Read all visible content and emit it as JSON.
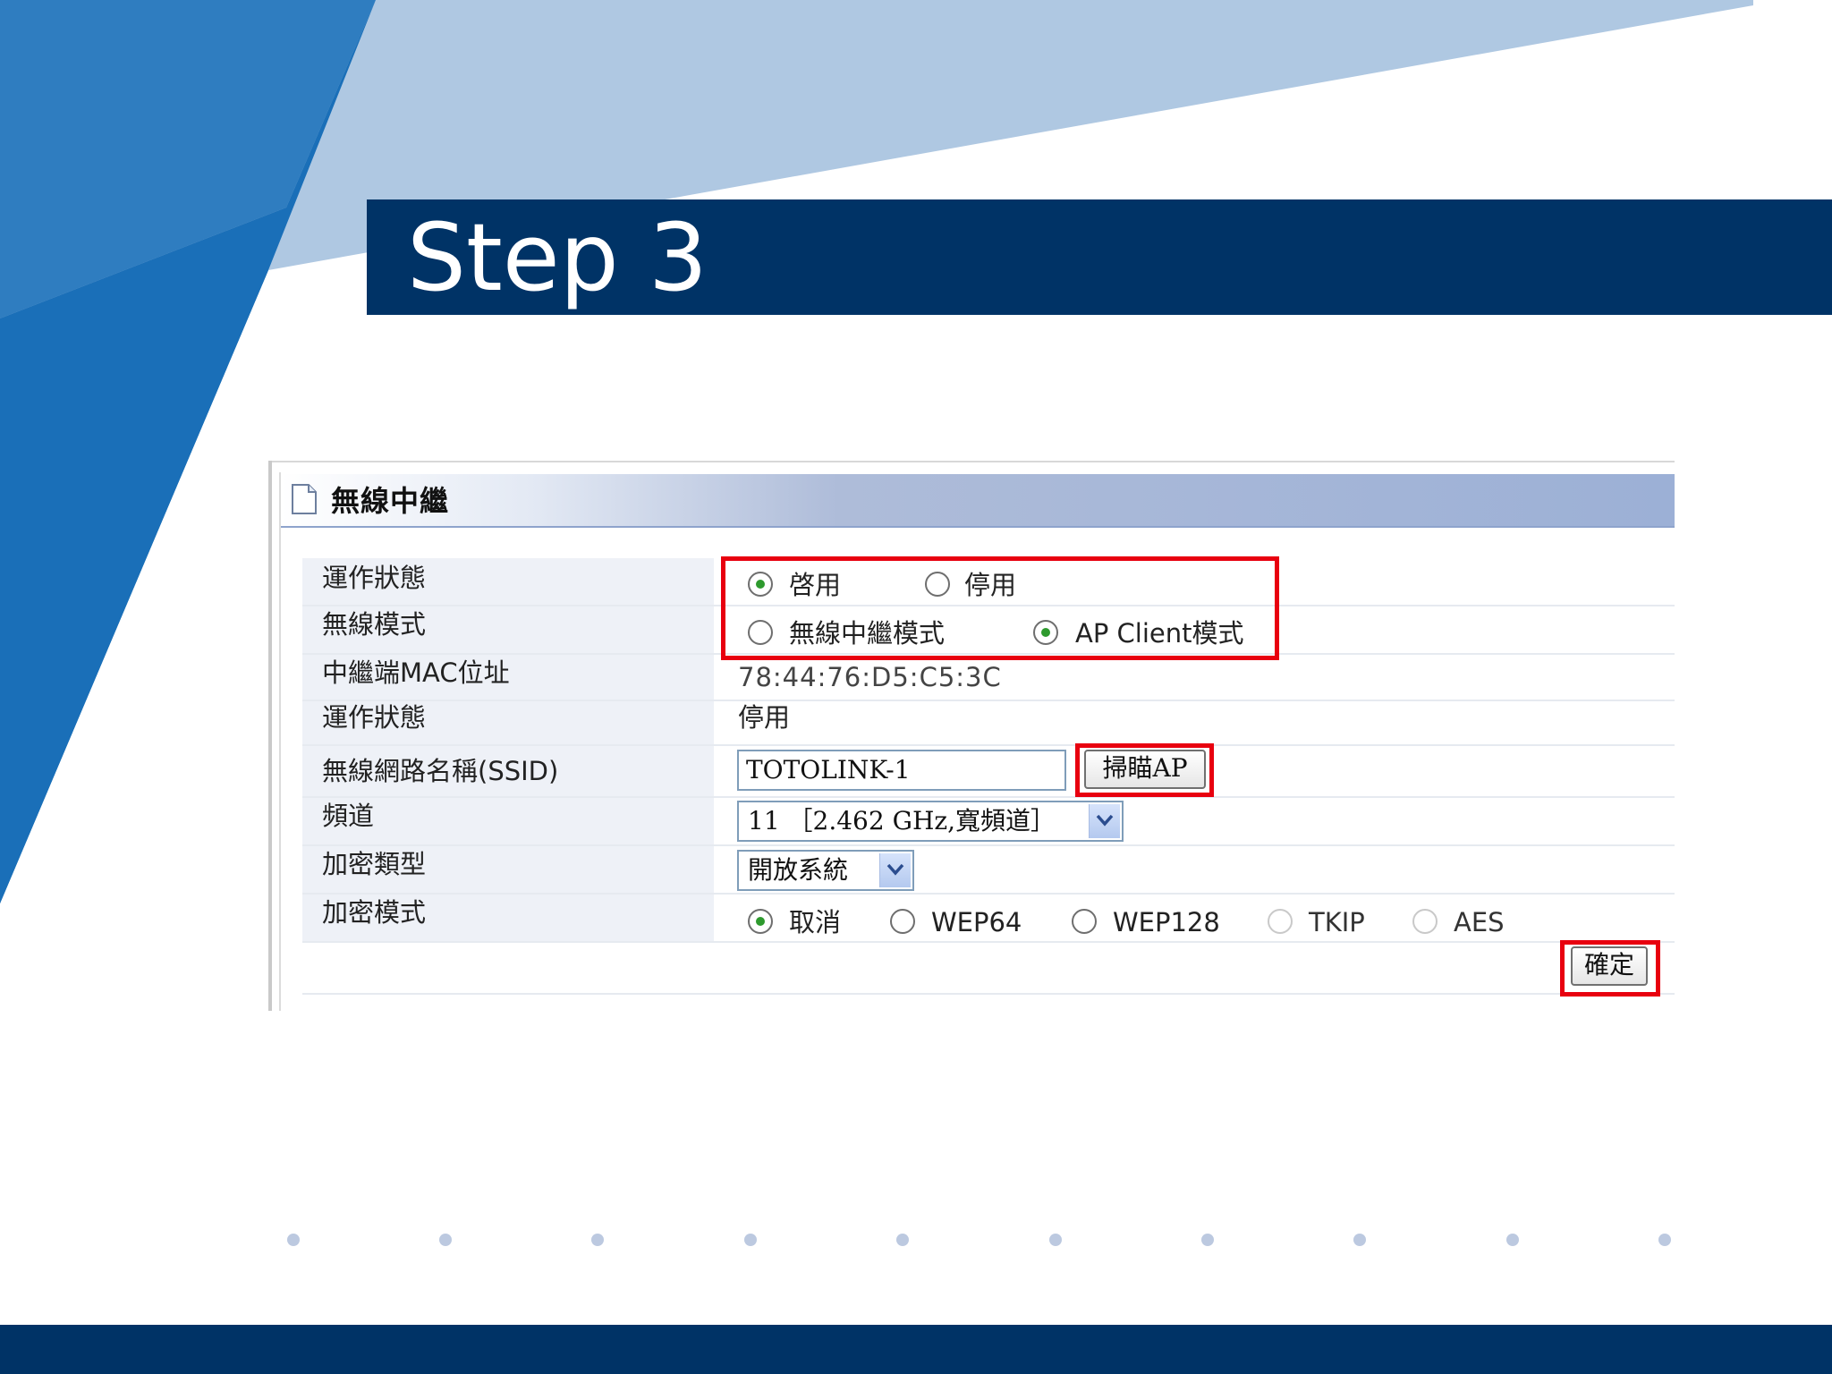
{
  "slide": {
    "title": "Step 3",
    "colors": {
      "navy": "#003366",
      "blue": "#0061ab",
      "light_blue": "#afc8e2",
      "highlight": "#e8000f"
    }
  },
  "panel": {
    "title": "無線中繼",
    "rows": {
      "status": {
        "label": "運作狀態",
        "options": [
          {
            "label": "啓用",
            "selected": true
          },
          {
            "label": "停用",
            "selected": false
          }
        ]
      },
      "mode": {
        "label": "無線模式",
        "options": [
          {
            "label": "無線中繼模式",
            "selected": false
          },
          {
            "label": "AP Client模式",
            "selected": true
          }
        ]
      },
      "mac": {
        "label": "中繼端MAC位址",
        "value": "78:44:76:D5:C5:3C"
      },
      "run_status": {
        "label": "運作狀態",
        "value": "停用"
      },
      "ssid": {
        "label": "無線網路名稱(SSID)",
        "value": "TOTOLINK-1",
        "scan_button": "掃瞄AP"
      },
      "channel": {
        "label": "頻道",
        "value": "11 ［2.462 GHz,寬頻道］"
      },
      "enc_type": {
        "label": "加密類型",
        "value": "開放系統"
      },
      "enc_mode": {
        "label": "加密模式",
        "options": [
          {
            "label": "取消",
            "selected": true
          },
          {
            "label": "WEP64",
            "selected": false
          },
          {
            "label": "WEP128",
            "selected": false
          },
          {
            "label": "TKIP",
            "selected": false
          },
          {
            "label": "AES",
            "selected": false
          }
        ]
      }
    },
    "confirm_button": "確定"
  }
}
